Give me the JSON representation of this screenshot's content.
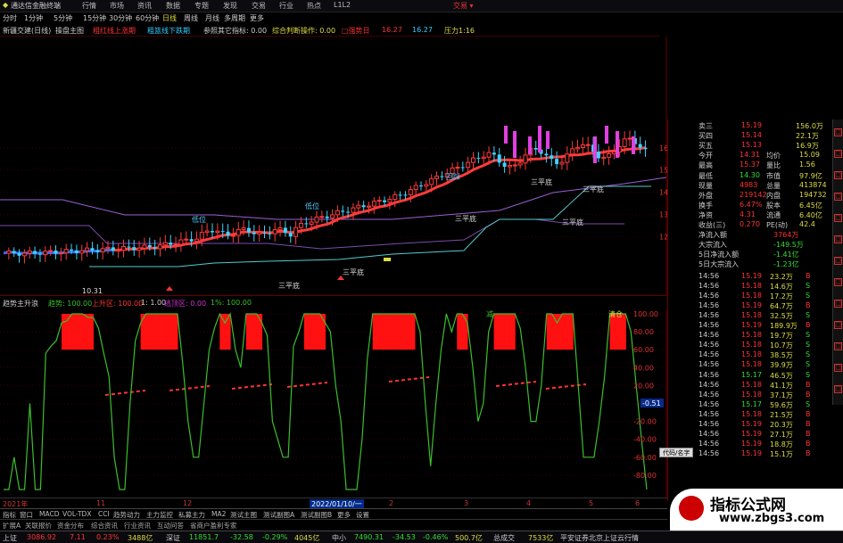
{
  "menu": {
    "app_title": "通达信金融终端",
    "items": [
      "行情",
      "市场",
      "资讯",
      "数据",
      "专题",
      "发现",
      "交易",
      "行业",
      "热点",
      "L1L2"
    ],
    "right_label": "交易 ▾"
  },
  "timeframes": {
    "items": [
      "分时",
      "1分钟",
      "5分钟",
      "15分钟",
      "30分钟",
      "60分钟",
      "日线",
      "周线",
      "月线",
      "多周期",
      "更多"
    ],
    "active": "日线"
  },
  "indicator_bar": {
    "items": [
      "新疆交建(日线)",
      "操盘主图",
      "粗红线上涨期",
      "粗篮线下跌期",
      "参照其它指标: 0.00",
      "综合判断操作: 0.00",
      "□强势日",
      "16.27",
      "16.27",
      "压力1:16"
    ]
  },
  "chart_labels": {
    "price_low_label": "10.31",
    "annotations": [
      "三平底",
      "三平底",
      "三平底",
      "三平底",
      "三平底",
      "三平底",
      "回踩",
      "低位",
      "低位"
    ]
  },
  "price_axis": [
    "16.00",
    "15.00",
    "14.00",
    "13.00",
    "12.00"
  ],
  "oscillator": {
    "header": [
      "趋势主升浪",
      "趋势: 100.00",
      "上升区: 100.00",
      "1: 1.00",
      "逃顶区: 0.00",
      "1%: 100.00"
    ],
    "axis": [
      "100.00",
      "80.00",
      "60.00",
      "40.00",
      "20.00",
      "-0.51",
      "-20.00",
      "-40.00",
      "-60.00",
      "-80.00"
    ],
    "markers": [
      "减",
      "清仓"
    ],
    "green_line": [
      2,
      2,
      20,
      2,
      2,
      50,
      2,
      2,
      78,
      82,
      85,
      95,
      96,
      100,
      100,
      100,
      98,
      98,
      92,
      78,
      65,
      20,
      2,
      2,
      50,
      85,
      95,
      100,
      100,
      100,
      100,
      100,
      100,
      100,
      72,
      40,
      20,
      20,
      50,
      80,
      92,
      100,
      95,
      100,
      80,
      70,
      100,
      100,
      100,
      95,
      88,
      40,
      30,
      20,
      20,
      82,
      90,
      100,
      100,
      100,
      100,
      95,
      90,
      60,
      40,
      2,
      2,
      2,
      30,
      75,
      100,
      100,
      100,
      100,
      100,
      100,
      100,
      100,
      100,
      90,
      50,
      15,
      50,
      80,
      100,
      90,
      100,
      100,
      95,
      70,
      40,
      50,
      90,
      100,
      100,
      100,
      100,
      100,
      92,
      70,
      40,
      40,
      60,
      100,
      100,
      95,
      100,
      100,
      100,
      60,
      20,
      20,
      20,
      40,
      65,
      100,
      100,
      100,
      100,
      90,
      60,
      30,
      2
    ]
  },
  "right_panel": {
    "quotes": [
      {
        "label": "卖三",
        "price": "15.19",
        "vol": "156.0万"
      },
      {
        "label": "买四",
        "price": "15.14",
        "vol": "22.1万"
      },
      {
        "label": "买五",
        "price": "15.13",
        "vol": "16.9万"
      }
    ],
    "stats": [
      {
        "l1": "今开",
        "v1": "14.31",
        "l2": "均价",
        "v2": "15.09"
      },
      {
        "l1": "最高",
        "v1": "15.37",
        "l2": "量比",
        "v2": "1.56"
      },
      {
        "l1": "最低",
        "v1": "14.30",
        "l2": "市值",
        "v2": "97.9亿"
      },
      {
        "l1": "现量",
        "v1": "4983",
        "l2": "总量",
        "v2": "413874"
      },
      {
        "l1": "外盘",
        "v1": "219142",
        "l2": "内盘",
        "v2": "194732"
      },
      {
        "l1": "换手",
        "v1": "6.47%",
        "l2": "股本",
        "v2": "6.45亿"
      },
      {
        "l1": "净资",
        "v1": "4.31",
        "l2": "流通",
        "v2": "6.40亿"
      },
      {
        "l1": "收益(三)",
        "v1": "0.270",
        "l2": "PE(动)",
        "v2": "42.4"
      }
    ],
    "flows": [
      {
        "label": "净流入额",
        "value": "3764万"
      },
      {
        "label": "大宗流入",
        "value": "-149.5万"
      },
      {
        "label": "5日净流入额",
        "value": "-1.41亿"
      },
      {
        "label": "5日大宗流入",
        "value": "-1.23亿"
      }
    ],
    "ticks": [
      {
        "t": "14:56",
        "p": "15.19",
        "v": "23.2万",
        "s": "B"
      },
      {
        "t": "14:56",
        "p": "15.18",
        "v": "14.6万",
        "s": "S"
      },
      {
        "t": "14:56",
        "p": "15.18",
        "v": "17.2万",
        "s": "S"
      },
      {
        "t": "14:56",
        "p": "15.19",
        "v": "64.7万",
        "s": "B"
      },
      {
        "t": "14:56",
        "p": "15.18",
        "v": "32.5万",
        "s": "S"
      },
      {
        "t": "14:56",
        "p": "15.19",
        "v": "189.9万",
        "s": "B"
      },
      {
        "t": "14:56",
        "p": "15.18",
        "v": "19.7万",
        "s": "S"
      },
      {
        "t": "14:56",
        "p": "15.18",
        "v": "10.7万",
        "s": "S"
      },
      {
        "t": "14:56",
        "p": "15.18",
        "v": "38.5万",
        "s": "S"
      },
      {
        "t": "14:56",
        "p": "15.18",
        "v": "39.9万",
        "s": "S"
      },
      {
        "t": "14:56",
        "p": "15.17",
        "v": "46.5万",
        "s": "S"
      },
      {
        "t": "14:56",
        "p": "15.18",
        "v": "41.1万",
        "s": "B"
      },
      {
        "t": "14:56",
        "p": "15.18",
        "v": "37.1万",
        "s": "B"
      },
      {
        "t": "14:56",
        "p": "15.17",
        "v": "59.6万",
        "s": "S"
      },
      {
        "t": "14:56",
        "p": "15.18",
        "v": "21.5万",
        "s": "B"
      },
      {
        "t": "14:56",
        "p": "15.19",
        "v": "20.3万",
        "s": "B"
      },
      {
        "t": "14:56",
        "p": "15.19",
        "v": "27.1万",
        "s": "B"
      },
      {
        "t": "14:56",
        "p": "15.19",
        "v": "18.8万",
        "s": "B"
      },
      {
        "t": "14:56",
        "p": "15.19",
        "v": "15.1万",
        "s": "B"
      }
    ],
    "small_button": "代码/名字"
  },
  "date_axis": [
    "2021年",
    "11",
    "12",
    "2022/01/10/一",
    "2",
    "3",
    "4",
    "5",
    "6"
  ],
  "tabs": [
    "指标",
    "窗口",
    "MACD",
    "VOL-TDX",
    "CCI",
    "趋势动力",
    "主力监控",
    "私募主力",
    "MA2",
    "测试主图",
    "测试副图A",
    "测试副图B",
    "更多",
    "设置"
  ],
  "tabs2": [
    "扩展A",
    "关联报价",
    "资金分布",
    "综合资讯",
    "行业资讯",
    "互动问答",
    "省商户盈利专家"
  ],
  "status": {
    "items": [
      "上证",
      "3086.92",
      "7.11",
      "0.23%",
      "3488亿",
      "深证",
      "11851.7",
      "-32.58",
      "-0.29%",
      "4045亿",
      "中小",
      "7490.31",
      "-34.53",
      "-0.46%",
      "500.7亿",
      "总成交",
      "7533亿",
      "平安证券北京上证云行情"
    ]
  },
  "watermark": {
    "line1": "指标公式网",
    "line2": "www.zbgs3.com"
  },
  "colors": {
    "up": "#ff3b3b",
    "down": "#3fd3ff",
    "red_band": "#ff1111",
    "green_line": "#3bbf2b",
    "blue_line": "#2e6fff",
    "purple_line": "#9a5fd6"
  }
}
